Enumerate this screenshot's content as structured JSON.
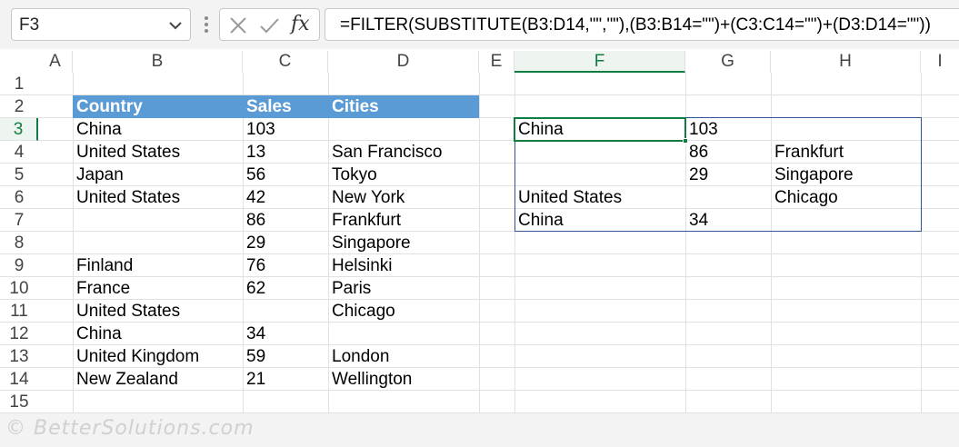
{
  "formula_bar": {
    "name_box": "F3",
    "formula": "=FILTER(SUBSTITUTE(B3:D14,\"\",\"\"),(B3:B14=\"\")+(C3:C14=\"\")+(D3:D14=\"\"))",
    "fx_label": "fx"
  },
  "columns": [
    "A",
    "B",
    "C",
    "D",
    "E",
    "F",
    "G",
    "H",
    "I"
  ],
  "selected_column": "F",
  "rows": [
    "1",
    "2",
    "3",
    "4",
    "5",
    "6",
    "7",
    "8",
    "9",
    "10",
    "11",
    "12",
    "13",
    "14",
    "15"
  ],
  "selected_row": "3",
  "table": {
    "headers": [
      "Country",
      "Sales",
      "Cities"
    ],
    "rows": [
      [
        "China",
        "103",
        ""
      ],
      [
        "United States",
        "13",
        "San Francisco"
      ],
      [
        "Japan",
        "56",
        "Tokyo"
      ],
      [
        "United States",
        "42",
        "New York"
      ],
      [
        "",
        "86",
        "Frankfurt"
      ],
      [
        "",
        "29",
        "Singapore"
      ],
      [
        "Finland",
        "76",
        "Helsinki"
      ],
      [
        "France",
        "62",
        "Paris"
      ],
      [
        "United States",
        "",
        "Chicago"
      ],
      [
        "China",
        "34",
        ""
      ],
      [
        "United Kingdom",
        "59",
        "London"
      ],
      [
        "New Zealand",
        "21",
        "Wellington"
      ]
    ]
  },
  "result": {
    "rows": [
      [
        "China",
        "103",
        ""
      ],
      [
        "",
        "86",
        "Frankfurt"
      ],
      [
        "",
        "29",
        "Singapore"
      ],
      [
        "United States",
        "",
        "Chicago"
      ],
      [
        "China",
        "34",
        ""
      ]
    ]
  },
  "footer": {
    "copyright": "© BetterSolutions.com"
  },
  "colors": {
    "header_fill": "#5b9bd5",
    "selection_green": "#107c41",
    "spill_border": "#2f5597"
  }
}
